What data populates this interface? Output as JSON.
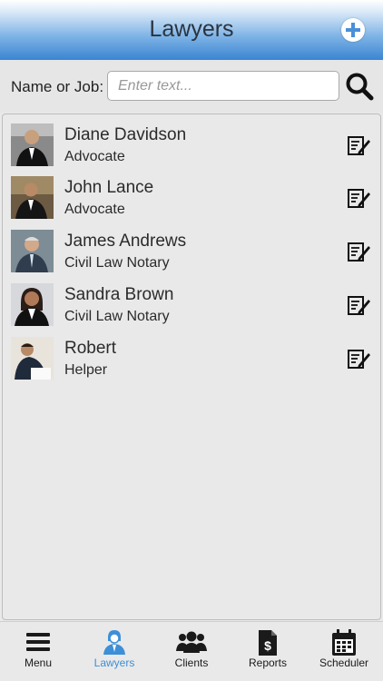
{
  "header": {
    "title": "Lawyers",
    "add_icon": "plus-circle-icon"
  },
  "search": {
    "label": "Name or Job:",
    "placeholder": "Enter text...",
    "value": "",
    "icon": "search-icon"
  },
  "lawyers": [
    {
      "name": "Diane Davidson",
      "job": "Advocate"
    },
    {
      "name": "John Lance",
      "job": "Advocate"
    },
    {
      "name": "James Andrews",
      "job": "Civil Law Notary"
    },
    {
      "name": "Sandra Brown",
      "job": "Civil Law Notary"
    },
    {
      "name": "Robert",
      "job": "Helper"
    }
  ],
  "tabs": [
    {
      "label": "Menu",
      "icon": "hamburger-menu-icon"
    },
    {
      "label": "Lawyers",
      "icon": "lawyer-icon",
      "active": true
    },
    {
      "label": "Clients",
      "icon": "users-group-icon"
    },
    {
      "label": "Reports",
      "icon": "report-dollar-icon"
    },
    {
      "label": "Scheduler",
      "icon": "calendar-icon"
    }
  ],
  "colors": {
    "accent": "#3d8fd8",
    "header_gradient_dark": "#3a85d2"
  }
}
